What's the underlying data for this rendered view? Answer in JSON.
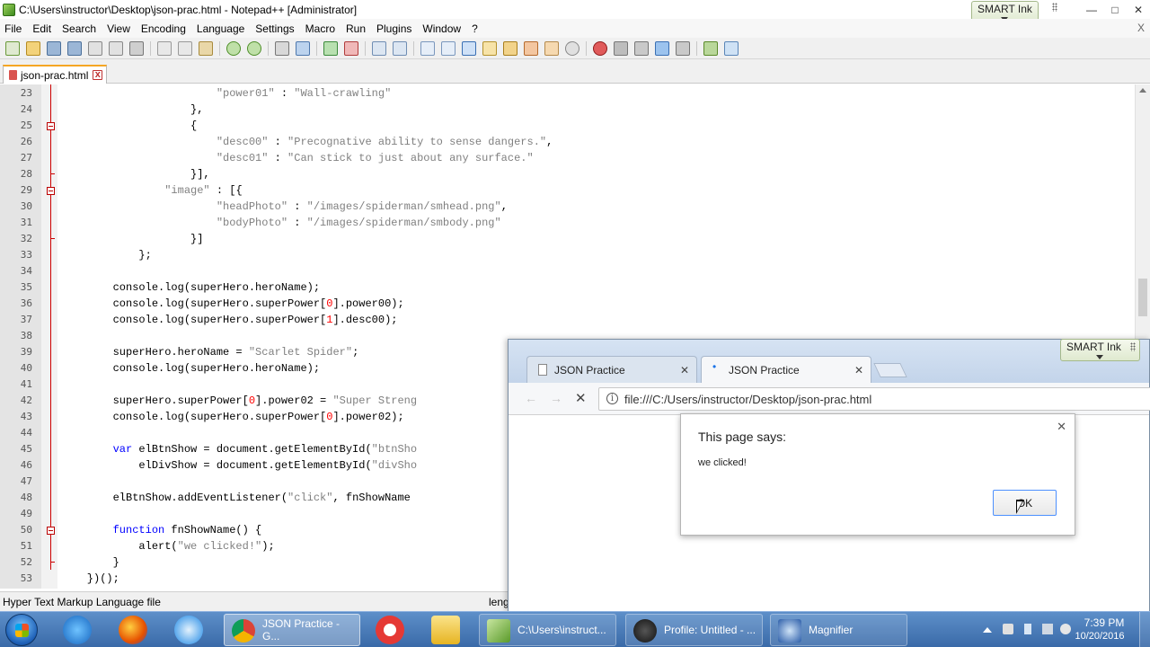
{
  "npp": {
    "title": "C:\\Users\\instructor\\Desktop\\json-prac.html - Notepad++ [Administrator]",
    "smart_ink": "SMART Ink",
    "win_min": "—",
    "win_max": "□",
    "win_close": "✕",
    "menu": [
      "File",
      "Edit",
      "Search",
      "View",
      "Encoding",
      "Language",
      "Settings",
      "Macro",
      "Run",
      "Plugins",
      "Window",
      "?"
    ],
    "doc_close": "X",
    "tab_label": "json-prac.html",
    "tab_close": "x",
    "line_numbers": [
      "23",
      "24",
      "25",
      "26",
      "27",
      "28",
      "29",
      "30",
      "31",
      "32",
      "33",
      "34",
      "35",
      "36",
      "37",
      "38",
      "39",
      "40",
      "41",
      "42",
      "43",
      "44",
      "45",
      "46",
      "47",
      "48",
      "49",
      "50",
      "51",
      "52",
      "53"
    ],
    "status_filetype": "Hyper Text Markup Language file",
    "status_length": "leng"
  },
  "chrome": {
    "smart_ink": "SMART Ink",
    "tab1_title": "JSON Practice",
    "tab2_title": "JSON Practice",
    "tab_close": "✕",
    "back": "←",
    "forward": "→",
    "stop": "✕",
    "info": "i",
    "url": "file:///C:/Users/instructor/Desktop/json-prac.html"
  },
  "alert": {
    "title": "This page says:",
    "message": "we clicked!",
    "ok_label": "OK",
    "close": "✕"
  },
  "taskbar": {
    "tasks": [
      {
        "label": "JSON Practice - G..."
      },
      {
        "label": "C:\\Users\\instruct..."
      },
      {
        "label": "Profile: Untitled - ..."
      },
      {
        "label": "Magnifier"
      }
    ],
    "clock_time": "7:39 PM",
    "clock_date": "10/20/2016"
  },
  "colors": {
    "code_string": "#808080",
    "code_keyword": "#0000ff",
    "code_number": "#ff0000",
    "fold_marker": "#cc0000",
    "taskbar": "#3a6aa8",
    "alert_ok_focus": "#4d90fe"
  },
  "icons": {
    "npp_app": "notepadpp-icon",
    "chrome_page": "page-icon",
    "start": "windows-start-icon"
  }
}
